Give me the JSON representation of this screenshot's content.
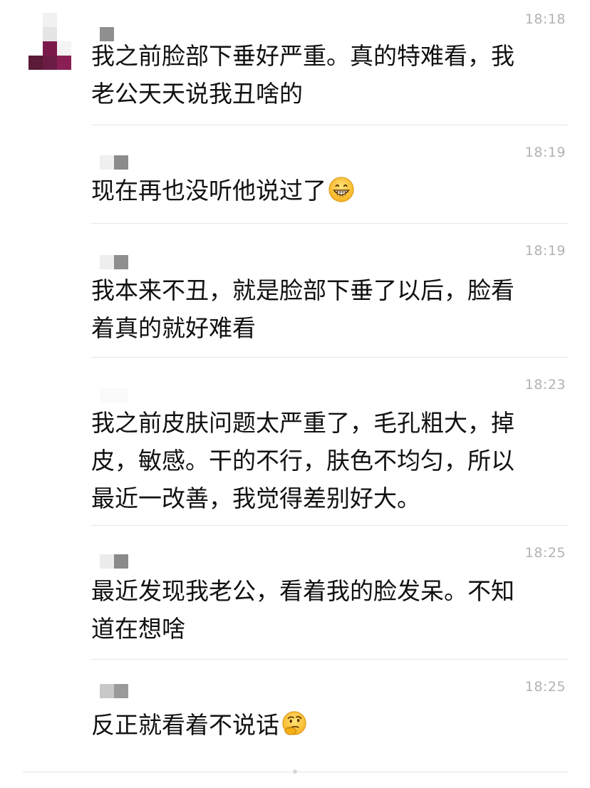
{
  "messages": [
    {
      "time": "18:18",
      "text": "我之前脸部下垂好严重。真的特难看，我\n老公天天说我丑啥的",
      "emoji": ""
    },
    {
      "time": "18:19",
      "text": "现在再也没听他说过了",
      "emoji": "grinning-face-icon"
    },
    {
      "time": "18:19",
      "text": "我本来不丑，就是脸部下垂了以后，脸看\n着真的就好难看",
      "emoji": ""
    },
    {
      "time": "18:23",
      "text": "我之前皮肤问题太严重了，毛孔粗大，掉\n皮，敏感。干的不行，肤色不均匀，所以\n最近一改善，我觉得差别好大。",
      "emoji": ""
    },
    {
      "time": "18:25",
      "text": "最近发现我老公，看着我的脸发呆。不知\n道在想啥",
      "emoji": ""
    },
    {
      "time": "18:25",
      "text": "反正就看着不说话",
      "emoji": "thinking-face-icon"
    }
  ],
  "colors": {
    "text": "#111111",
    "time": "#b2b2b2",
    "separator": "#e6e6e6",
    "avatar_accent": "#8a1f55"
  }
}
